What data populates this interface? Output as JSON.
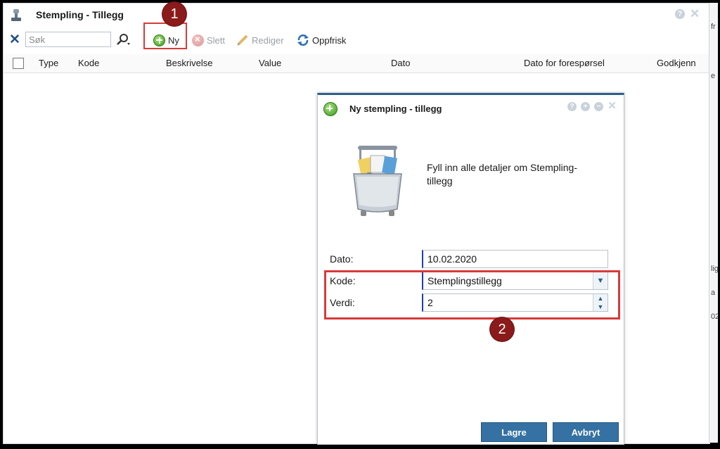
{
  "window": {
    "title": "Stempling - Tillegg",
    "help_glyph": "?",
    "close_glyph": "✕"
  },
  "toolbar": {
    "clear_glyph": "✕",
    "search_placeholder": "Søk",
    "new_label": "Ny",
    "delete_label": "Slett",
    "edit_label": "Rediger",
    "refresh_label": "Oppfrisk"
  },
  "grid": {
    "columns": [
      "Type",
      "Kode",
      "Beskrivelse",
      "Value",
      "Dato",
      "Dato for forespørsel",
      "Godkjenn"
    ]
  },
  "annotations": {
    "badge1": "1",
    "badge2": "2"
  },
  "dialog": {
    "title": "Ny stempling - tillegg",
    "intro": "Fyll inn alle detaljer om Stempling-tillegg",
    "fields": {
      "dato_label": "Dato:",
      "dato_value": "10.02.2020",
      "kode_label": "Kode:",
      "kode_value": "Stemplingstillegg",
      "verdi_label": "Verdi:",
      "verdi_value": "2"
    },
    "save_label": "Lagre",
    "cancel_label": "Avbryt",
    "ctrl_glyphs": {
      "help": "?",
      "max": "+",
      "min": "−",
      "close": "✕"
    }
  },
  "background_edge_text": {
    "t1": "fr",
    "t2": "e",
    "t3": "lig",
    "t4": "a",
    "t5": "02"
  },
  "colors": {
    "accent": "#2d5f8a",
    "button": "#3572a3",
    "highlight": "#d93a3a",
    "badge": "#8b1a1a"
  }
}
